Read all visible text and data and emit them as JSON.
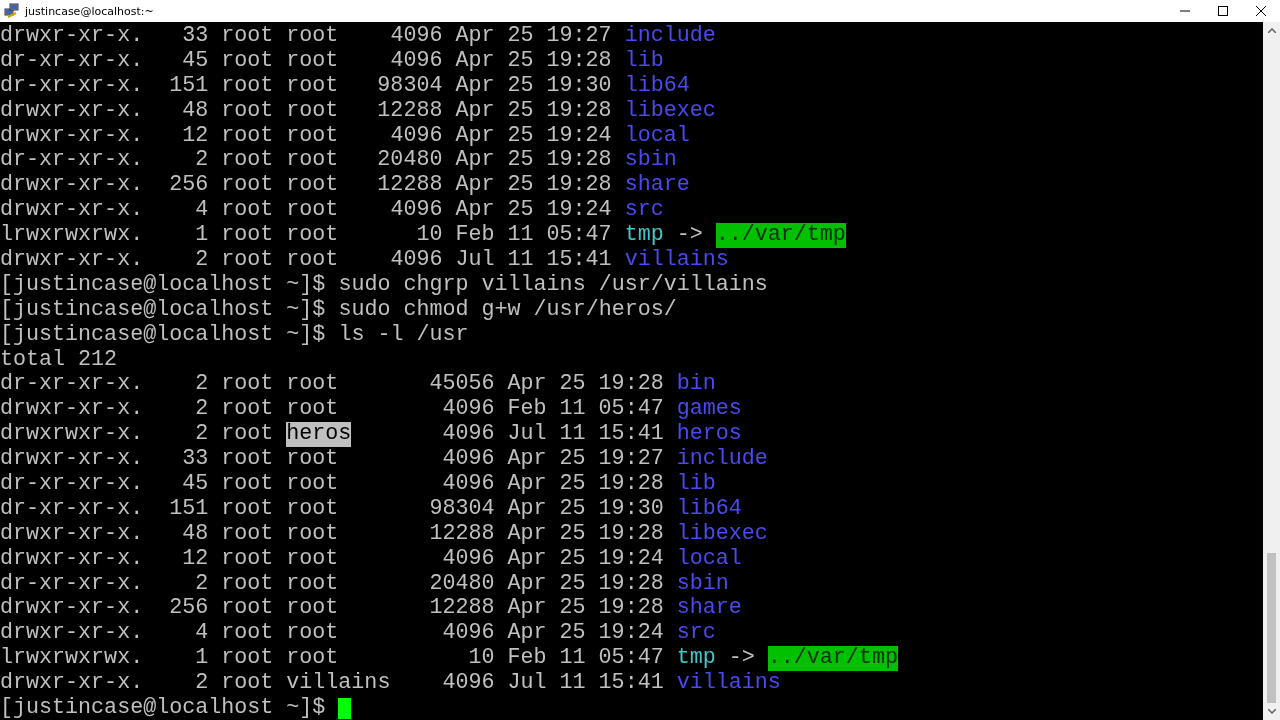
{
  "window": {
    "title": "justincase@localhost:~"
  },
  "lines": [
    {
      "kind": "dir",
      "perms": "drwxr-xr-x.",
      "links": "33",
      "owner": "root",
      "group": "root",
      "group_selected": false,
      "bytes": "4096",
      "date": "Apr 25 19:27",
      "name": "include"
    },
    {
      "kind": "dir",
      "perms": "dr-xr-xr-x.",
      "links": "45",
      "owner": "root",
      "group": "root",
      "group_selected": false,
      "bytes": "4096",
      "date": "Apr 25 19:28",
      "name": "lib"
    },
    {
      "kind": "dir",
      "perms": "dr-xr-xr-x.",
      "links": "151",
      "owner": "root",
      "group": "root",
      "group_selected": false,
      "bytes": "98304",
      "date": "Apr 25 19:30",
      "name": "lib64"
    },
    {
      "kind": "dir",
      "perms": "drwxr-xr-x.",
      "links": "48",
      "owner": "root",
      "group": "root",
      "group_selected": false,
      "bytes": "12288",
      "date": "Apr 25 19:28",
      "name": "libexec"
    },
    {
      "kind": "dir",
      "perms": "drwxr-xr-x.",
      "links": "12",
      "owner": "root",
      "group": "root",
      "group_selected": false,
      "bytes": "4096",
      "date": "Apr 25 19:24",
      "name": "local"
    },
    {
      "kind": "dir",
      "perms": "dr-xr-xr-x.",
      "links": "2",
      "owner": "root",
      "group": "root",
      "group_selected": false,
      "bytes": "20480",
      "date": "Apr 25 19:28",
      "name": "sbin"
    },
    {
      "kind": "dir",
      "perms": "drwxr-xr-x.",
      "links": "256",
      "owner": "root",
      "group": "root",
      "group_selected": false,
      "bytes": "12288",
      "date": "Apr 25 19:28",
      "name": "share"
    },
    {
      "kind": "dir",
      "perms": "drwxr-xr-x.",
      "links": "4",
      "owner": "root",
      "group": "root",
      "group_selected": false,
      "bytes": "4096",
      "date": "Apr 25 19:24",
      "name": "src"
    },
    {
      "kind": "link",
      "perms": "lrwxrwxrwx.",
      "links": "1",
      "owner": "root",
      "group": "root",
      "group_selected": false,
      "bytes": "10",
      "date": "Feb 11 05:47",
      "name": "tmp",
      "arrow": "->",
      "target": "../var/tmp"
    },
    {
      "kind": "dir",
      "perms": "drwxr-xr-x.",
      "links": "2",
      "owner": "root",
      "group": "root",
      "group_selected": false,
      "bytes": "4096",
      "date": "Jul 11 15:41",
      "name": "villains"
    },
    {
      "kind": "prompt",
      "prompt": "[justincase@localhost ~]$",
      "command": "sudo chgrp villains /usr/villains",
      "cursor": false
    },
    {
      "kind": "prompt",
      "prompt": "[justincase@localhost ~]$",
      "command": "sudo chmod g+w /usr/heros/",
      "cursor": false
    },
    {
      "kind": "prompt",
      "prompt": "[justincase@localhost ~]$",
      "command": "ls -l /usr",
      "cursor": false
    },
    {
      "kind": "output",
      "text": "total 212"
    },
    {
      "kind": "dir",
      "perms": "dr-xr-xr-x.",
      "links": "2",
      "owner": "root",
      "group": "root",
      "group_selected": false,
      "bytes": "45056",
      "date": "Apr 25 19:28",
      "name": "bin"
    },
    {
      "kind": "dir",
      "perms": "drwxr-xr-x.",
      "links": "2",
      "owner": "root",
      "group": "root",
      "group_selected": false,
      "bytes": "4096",
      "date": "Feb 11 05:47",
      "name": "games"
    },
    {
      "kind": "dir",
      "perms": "drwxrwxr-x.",
      "links": "2",
      "owner": "root",
      "group": "heros",
      "group_selected": true,
      "bytes": "4096",
      "date": "Jul 11 15:41",
      "name": "heros"
    },
    {
      "kind": "dir",
      "perms": "drwxr-xr-x.",
      "links": "33",
      "owner": "root",
      "group": "root",
      "group_selected": false,
      "bytes": "4096",
      "date": "Apr 25 19:27",
      "name": "include"
    },
    {
      "kind": "dir",
      "perms": "dr-xr-xr-x.",
      "links": "45",
      "owner": "root",
      "group": "root",
      "group_selected": false,
      "bytes": "4096",
      "date": "Apr 25 19:28",
      "name": "lib"
    },
    {
      "kind": "dir",
      "perms": "dr-xr-xr-x.",
      "links": "151",
      "owner": "root",
      "group": "root",
      "group_selected": false,
      "bytes": "98304",
      "date": "Apr 25 19:30",
      "name": "lib64"
    },
    {
      "kind": "dir",
      "perms": "drwxr-xr-x.",
      "links": "48",
      "owner": "root",
      "group": "root",
      "group_selected": false,
      "bytes": "12288",
      "date": "Apr 25 19:28",
      "name": "libexec"
    },
    {
      "kind": "dir",
      "perms": "drwxr-xr-x.",
      "links": "12",
      "owner": "root",
      "group": "root",
      "group_selected": false,
      "bytes": "4096",
      "date": "Apr 25 19:24",
      "name": "local"
    },
    {
      "kind": "dir",
      "perms": "dr-xr-xr-x.",
      "links": "2",
      "owner": "root",
      "group": "root",
      "group_selected": false,
      "bytes": "20480",
      "date": "Apr 25 19:28",
      "name": "sbin"
    },
    {
      "kind": "dir",
      "perms": "drwxr-xr-x.",
      "links": "256",
      "owner": "root",
      "group": "root",
      "group_selected": false,
      "bytes": "12288",
      "date": "Apr 25 19:28",
      "name": "share"
    },
    {
      "kind": "dir",
      "perms": "drwxr-xr-x.",
      "links": "4",
      "owner": "root",
      "group": "root",
      "group_selected": false,
      "bytes": "4096",
      "date": "Apr 25 19:24",
      "name": "src"
    },
    {
      "kind": "link",
      "perms": "lrwxrwxrwx.",
      "links": "1",
      "owner": "root",
      "group": "root",
      "group_selected": false,
      "bytes": "10",
      "date": "Feb 11 05:47",
      "name": "tmp",
      "arrow": "->",
      "target": "../var/tmp"
    },
    {
      "kind": "dir",
      "perms": "drwxr-xr-x.",
      "links": "2",
      "owner": "root",
      "group": "villains",
      "group_selected": false,
      "bytes": "4096",
      "date": "Jul 11 15:41",
      "name": "villains"
    },
    {
      "kind": "prompt",
      "prompt": "[justincase@localhost ~]$",
      "cursor": true
    }
  ]
}
